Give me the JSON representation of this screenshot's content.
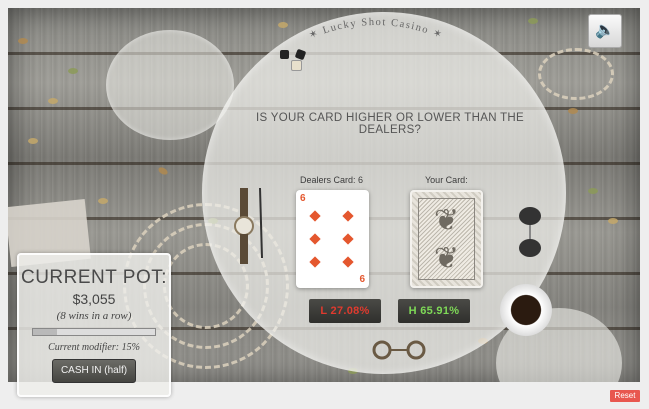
{
  "casino": {
    "arc_title": "Lucky Shot Casino"
  },
  "game": {
    "question": "IS YOUR CARD HIGHER OR LOWER THAN THE DEALERS?",
    "dealer_label": "Dealers Card: 6",
    "your_label": "Your Card:",
    "dealer_card": {
      "rank": "6",
      "suit": "diamonds",
      "color": "#e4572e"
    },
    "odds": {
      "low": "L 27.08%",
      "high": "H 65.91%"
    }
  },
  "pot": {
    "title": "CURRENT POT:",
    "amount": "$3,055",
    "wins": "(8 wins in a row)",
    "progress": 0.2,
    "modifier": "Current modifier: 15%",
    "cash_label": "CASH IN (half)"
  },
  "controls": {
    "sound_icon": "speaker-icon",
    "reset_label": "Reset"
  },
  "colors": {
    "reset": "#e8574f",
    "low": "#e03a2e",
    "high": "#7ed957",
    "suit": "#e4572e"
  }
}
